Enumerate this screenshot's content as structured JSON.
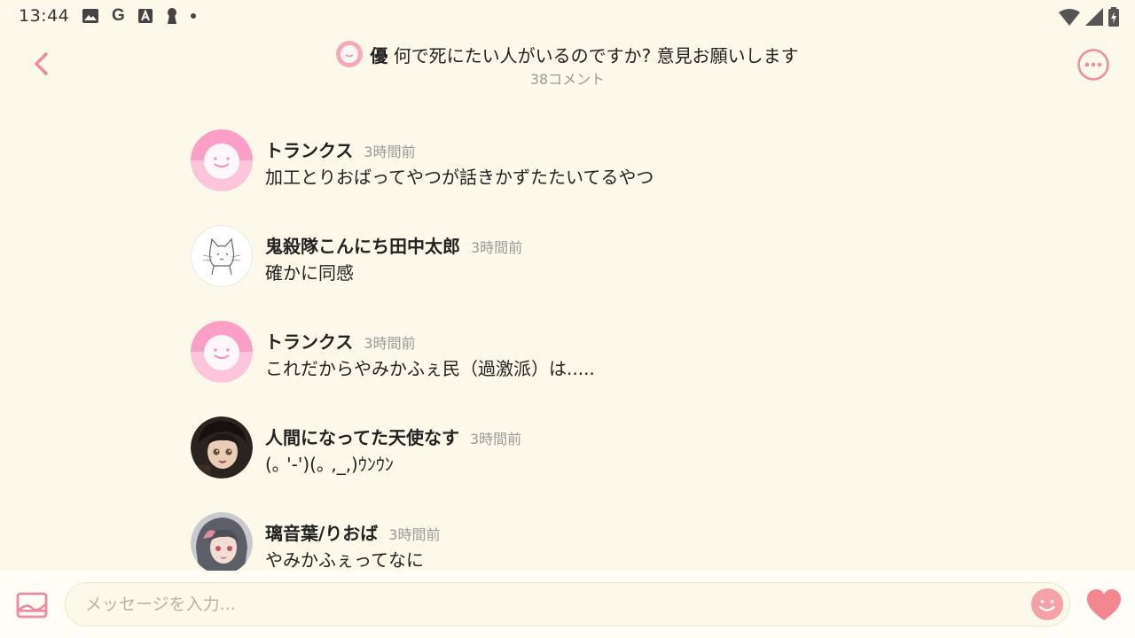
{
  "status_bar": {
    "time": "13:44",
    "google_letter": "G",
    "icons": [
      "image-icon",
      "google-icon",
      "font-a-icon",
      "keyhole-icon",
      "dot-icon",
      "wifi-icon",
      "signal-icon",
      "battery-charging-icon"
    ]
  },
  "header": {
    "post_author": "優",
    "post_title": "何で死にたい人がいるのですか? 意見お願いします",
    "comment_count": "38コメント"
  },
  "comments": [
    {
      "user": "トランクス",
      "time": "3時間前",
      "text": "加工とりおばってやつが話きかずたたいてるやつ",
      "avatar": "pink-face-avatar"
    },
    {
      "user": "鬼殺隊こんにち田中太郎",
      "time": "3時間前",
      "text": "確かに同感",
      "avatar": "cat-sketch-avatar"
    },
    {
      "user": "トランクス",
      "time": "3時間前",
      "text": "これだからやみかふぇ民（過激派）は.....",
      "avatar": "pink-face-avatar"
    },
    {
      "user": "人間になってた天使なす",
      "time": "3時間前",
      "text": "(｡ '-')(｡ ,_,)ｳﾝｳﾝ",
      "avatar": "anime-girl-avatar"
    },
    {
      "user": "璃音葉/りおば",
      "time": "3時間前",
      "text": "やみかふぇってなに",
      "avatar": "anime-girl-grey-avatar"
    }
  ],
  "composer": {
    "placeholder": "メッセージを入力..."
  },
  "colors": {
    "accent": "#f08a9c",
    "background": "#fdf9ea",
    "muted_text": "#999999"
  }
}
